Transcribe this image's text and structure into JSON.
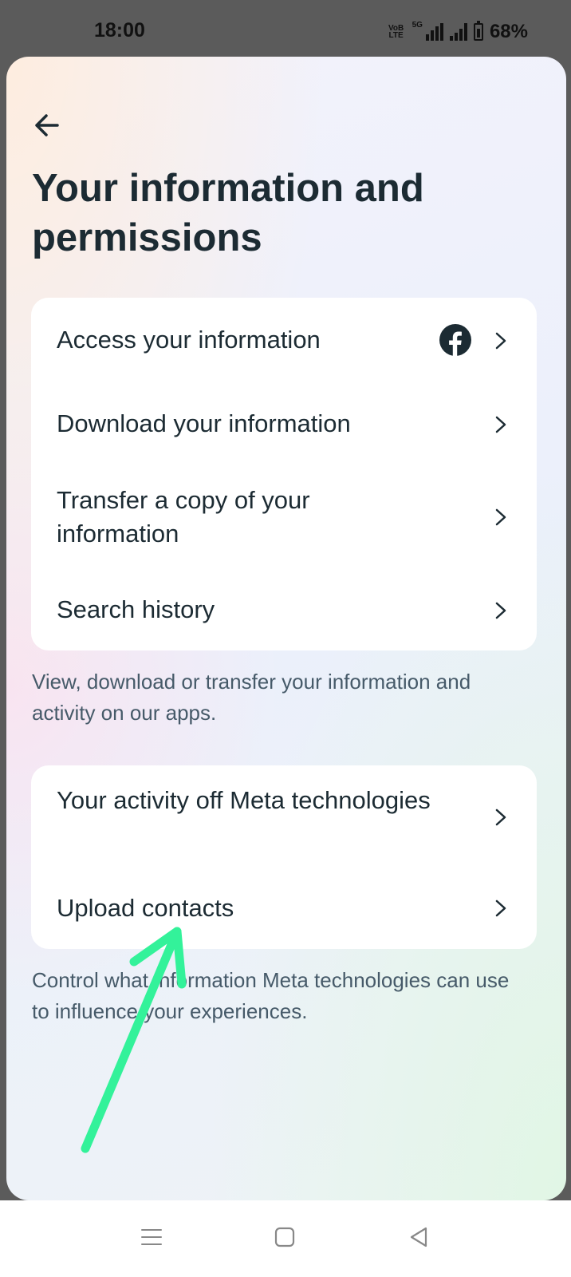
{
  "status_bar": {
    "time": "18:00",
    "network_badge_top": "VoB",
    "network_badge_bottom": "LTE",
    "network_type": "5G",
    "battery": "68%"
  },
  "header": {
    "back_icon": "back-arrow-icon",
    "title": "Your information and permissions"
  },
  "section_information": {
    "items": [
      {
        "label": "Access your information",
        "trailing_icon": "facebook-icon"
      },
      {
        "label": "Download your information"
      },
      {
        "label": "Transfer a copy of your information"
      },
      {
        "label": "Search history"
      }
    ],
    "caption": "View, download or transfer your information and activity on our apps."
  },
  "section_activity": {
    "items": [
      {
        "label": "Your activity off Meta technologies"
      },
      {
        "label": "Upload contacts"
      }
    ],
    "caption": "Control what information Meta technologies can use to influence your experiences."
  },
  "annotation": {
    "type": "arrow",
    "color": "#33f29a",
    "points_to": "Upload contacts"
  },
  "nav_bar": {
    "buttons": [
      "menu-icon",
      "home-icon",
      "back-triangle-icon"
    ]
  },
  "colors": {
    "title_text": "#1c2b33",
    "caption_text": "#465a69",
    "facebook_blue": "#1c2b33",
    "status_bar_bg": "#5b5b5b"
  }
}
